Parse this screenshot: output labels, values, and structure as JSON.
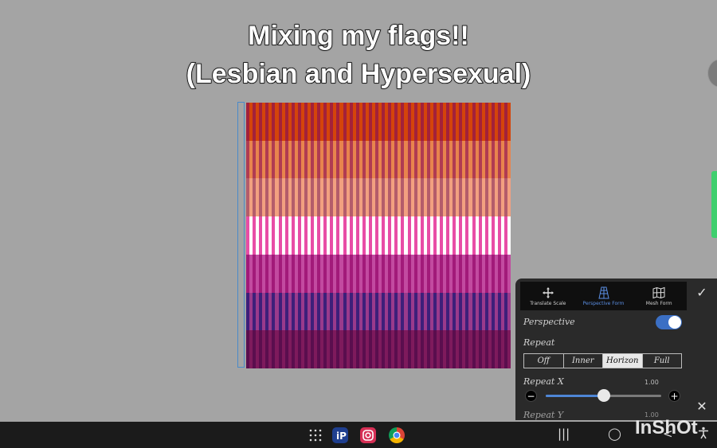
{
  "captions": {
    "line1": "Mixing my flags!!",
    "line2": "(Lesbian and Hypersexual)"
  },
  "flag": {
    "bands": [
      "#d4440a",
      "#e8844d",
      "#f2a080",
      "#ffffff",
      "#c24aa0",
      "#9a3a8c",
      "#7e1a5c"
    ],
    "stripe_colors": [
      "#a3213a",
      "#b03b52",
      "#b45c6a",
      "#e84da6",
      "#a21a79",
      "#3d1f7a",
      "#5a0e4e"
    ]
  },
  "panel": {
    "tabs": [
      {
        "label": "Translate Scale",
        "icon": "move-icon"
      },
      {
        "label": "Perspective Form",
        "icon": "perspective-grid-icon"
      },
      {
        "label": "Mesh Form",
        "icon": "map-mesh-icon"
      }
    ],
    "active_tab": 1,
    "confirm_icon": "checkmark-icon",
    "close_icon": "close-icon",
    "perspective_label": "Perspective",
    "perspective_on": true,
    "repeat_label": "Repeat",
    "repeat_options": [
      "Off",
      "Inner",
      "Horizon",
      "Full"
    ],
    "repeat_selected": 2,
    "repeat_x_label": "Repeat X",
    "repeat_x_value": "1.00",
    "repeat_x_level": 0.5,
    "repeat_y_label": "Repeat Y",
    "repeat_y_value": "1.00",
    "minus": "−",
    "plus": "+"
  },
  "taskbar": {
    "apps": [
      "app-grid-icon",
      "ibis-paint-icon",
      "instagram-icon",
      "chrome-icon"
    ],
    "nav": {
      "recents": "|||",
      "home": "◯",
      "back": "<"
    },
    "accessibility_icon": "accessibility-icon"
  },
  "watermark": "InShOt"
}
